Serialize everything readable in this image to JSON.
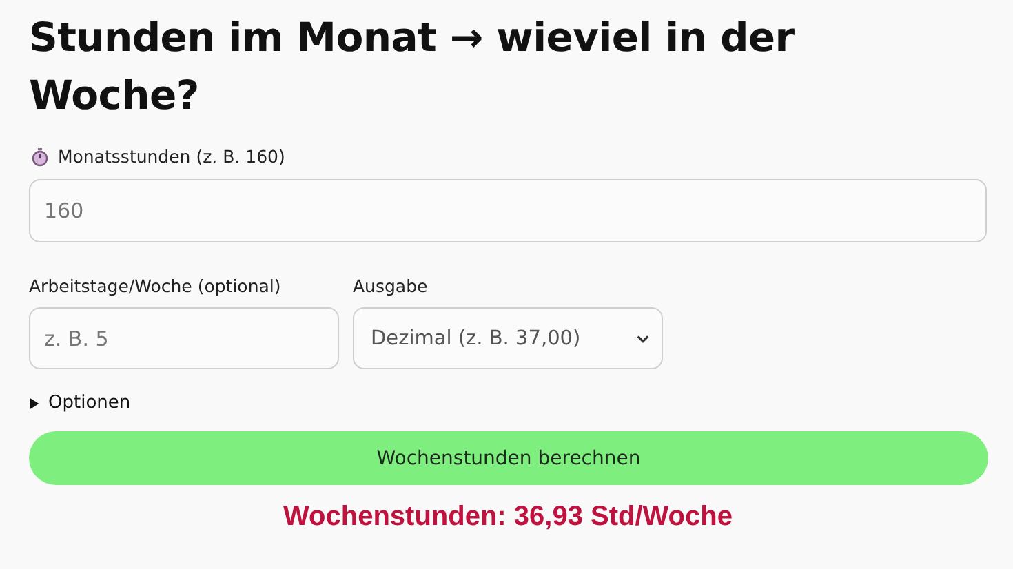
{
  "title": "Stunden im Monat → wieviel in der Woche?",
  "hours_field": {
    "label": "Monatsstunden (z. B. 160)",
    "placeholder": "160"
  },
  "days_field": {
    "label": "Arbeitstage/Woche (optional)",
    "placeholder": "z. B. 5"
  },
  "output_select": {
    "label": "Ausgabe",
    "value": "Dezimal (z. B. 37,00)"
  },
  "options": {
    "label": "Optionen",
    "expanded": false
  },
  "calculate_button": "Wochenstunden berechnen",
  "result": "Wochenstunden: 36,93 Std/Woche"
}
